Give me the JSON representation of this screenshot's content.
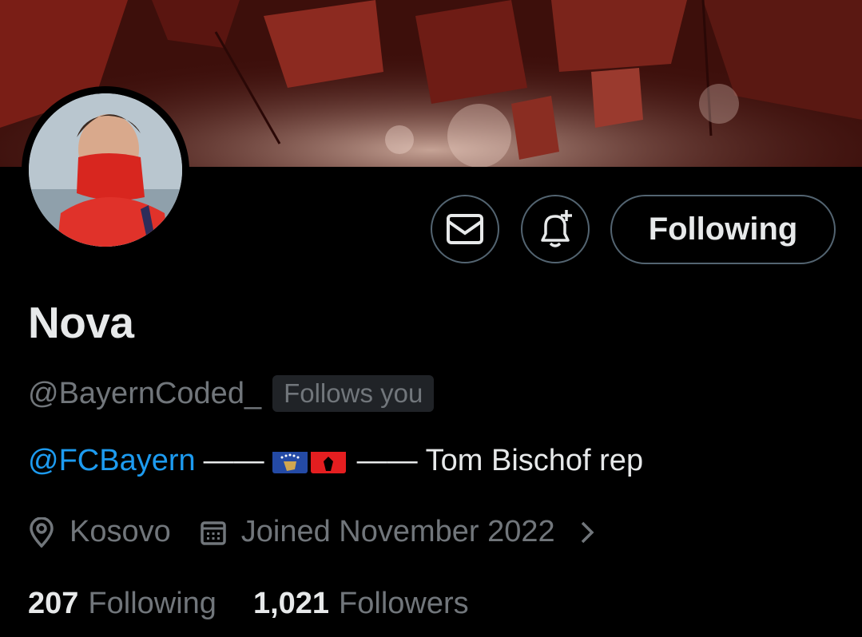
{
  "profile": {
    "name": "Nova",
    "handle": "@BayernCoded_",
    "follows_you": "Follows you",
    "bio": {
      "mention": "@FCBayern",
      "dash1": "——",
      "flags": [
        "Kosovo flag",
        "Albania flag"
      ],
      "dash2": "——",
      "tail": "Tom Bischof rep"
    },
    "location": "Kosovo",
    "joined": "Joined November 2022",
    "following_count": "207",
    "following_label": "Following",
    "followers_count": "1,021",
    "followers_label": "Followers"
  },
  "actions": {
    "message_icon": "envelope-icon",
    "notify_icon": "bell-plus-icon",
    "follow_label": "Following"
  },
  "colors": {
    "background": "#000000",
    "text_primary": "#e7e9ea",
    "text_secondary": "#71767b",
    "accent": "#1d9bf0",
    "border": "#536471"
  }
}
